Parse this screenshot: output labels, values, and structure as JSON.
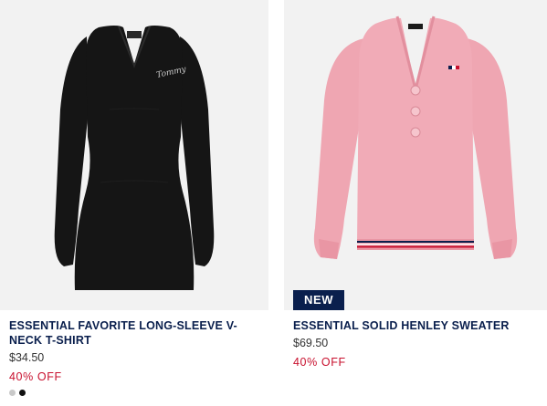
{
  "products": [
    {
      "title": "ESSENTIAL FAVORITE LONG-SLEEVE V-NECK T-SHIRT",
      "price": "$34.50",
      "discount": "40% OFF",
      "image": "black-vneck-tshirt-image",
      "garment_color": "#111111",
      "print_text": "Tommy",
      "swatches": [
        {
          "name": "light-grey-swatch",
          "color": "#c9c9c9"
        },
        {
          "name": "black-swatch",
          "color": "#111111"
        }
      ]
    },
    {
      "badge": "NEW",
      "title": "ESSENTIAL SOLID HENLEY SWEATER",
      "price": "$69.50",
      "discount": "40% OFF",
      "image": "pink-henley-sweater-image",
      "garment_color": "#f0a9b5"
    }
  ],
  "colors": {
    "navy": "#0a1f4d",
    "sale_red": "#c8102e",
    "image_bg": "#f2f2f2"
  }
}
